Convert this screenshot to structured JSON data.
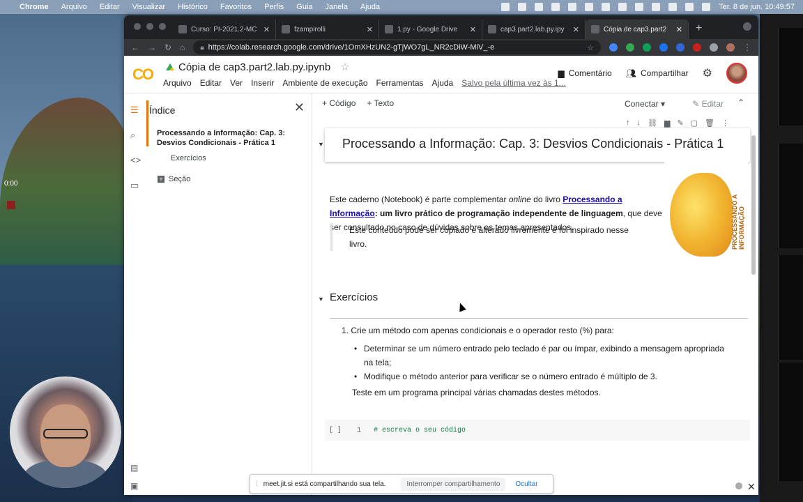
{
  "menubar": {
    "app": "Chrome",
    "items": [
      "Arquivo",
      "Editar",
      "Visualizar",
      "Histórico",
      "Favoritos",
      "Perfis",
      "Guia",
      "Janela",
      "Ajuda"
    ],
    "clock": "Ter. 8 de jun.  10:49:57"
  },
  "desktop": {
    "timer": "0:00"
  },
  "tabs": [
    {
      "title": "Curso: PI-2021.2-MC",
      "active": false
    },
    {
      "title": "fzampirolli",
      "active": false
    },
    {
      "title": "1.py - Google Drive",
      "active": false
    },
    {
      "title": "cap3.part2.lab.py.ipy",
      "active": false
    },
    {
      "title": "Cópia de cap3.part2",
      "active": true
    }
  ],
  "address": {
    "url": "https://colab.research.google.com/drive/1OmXHzUN2-gTjWO7gL_NR2cDiW-MiV_-e"
  },
  "colab": {
    "logo": "CO",
    "notebook_title": "Cópia de cap3.part2.lab.py.ipynb",
    "menu": [
      "Arquivo",
      "Editar",
      "Ver",
      "Inserir",
      "Ambiente de execução",
      "Ferramentas",
      "Ajuda"
    ],
    "saved": "Salvo pela última vez às 1...",
    "comment": "Comentário",
    "share": "Compartilhar"
  },
  "toc": {
    "title": "Índice",
    "item1": "Processando a Informação: Cap. 3: Desvios Condicionais - Prática 1",
    "item2": "Exercícios",
    "item3": "Seção"
  },
  "toolbar": {
    "code": "Código",
    "text": "Texto",
    "connect": "Conectar",
    "edit": "Editar"
  },
  "notebook": {
    "h1": "Processando a Informação: Cap. 3: Desvios Condicionais - Prática 1",
    "para_pre": "Este caderno (Notebook) é parte complementar ",
    "para_em": "online",
    "para_mid": " do livro ",
    "para_link": "Processando a Informação",
    "para_bold": ": um livro prático de programação independente de linguagem",
    "para_post": ", que deve ser consultado no caso de dúvidas sobre os temas apresentados.",
    "quote": "Este conteúdo pode ser copiado e alterado livremente e foi inspirado nesse livro.",
    "book_title": "PROCESSANDO A INFORMAÇÃO",
    "h2": "Exercícios",
    "ol_num": "1.",
    "ol_item": "Crie um método com apenas condicionais e o operador resto (%) para:",
    "bullet1": "Determinar se um número entrado pelo teclado é par ou ímpar, exibindo a mensagem apropriada na tela;",
    "bullet2": "Modifique o método anterior para verificar se o número entrado é múltiplo de 3.",
    "teste": "Teste em um programa principal várias chamadas destes métodos.",
    "code_run": "[ ]",
    "code_line": "1",
    "code": "# escreva o seu código"
  },
  "share_banner": {
    "message": "meet.jit.si está compartilhando sua tela.",
    "stop": "Interromper compartilhamento",
    "hide": "Ocultar"
  }
}
